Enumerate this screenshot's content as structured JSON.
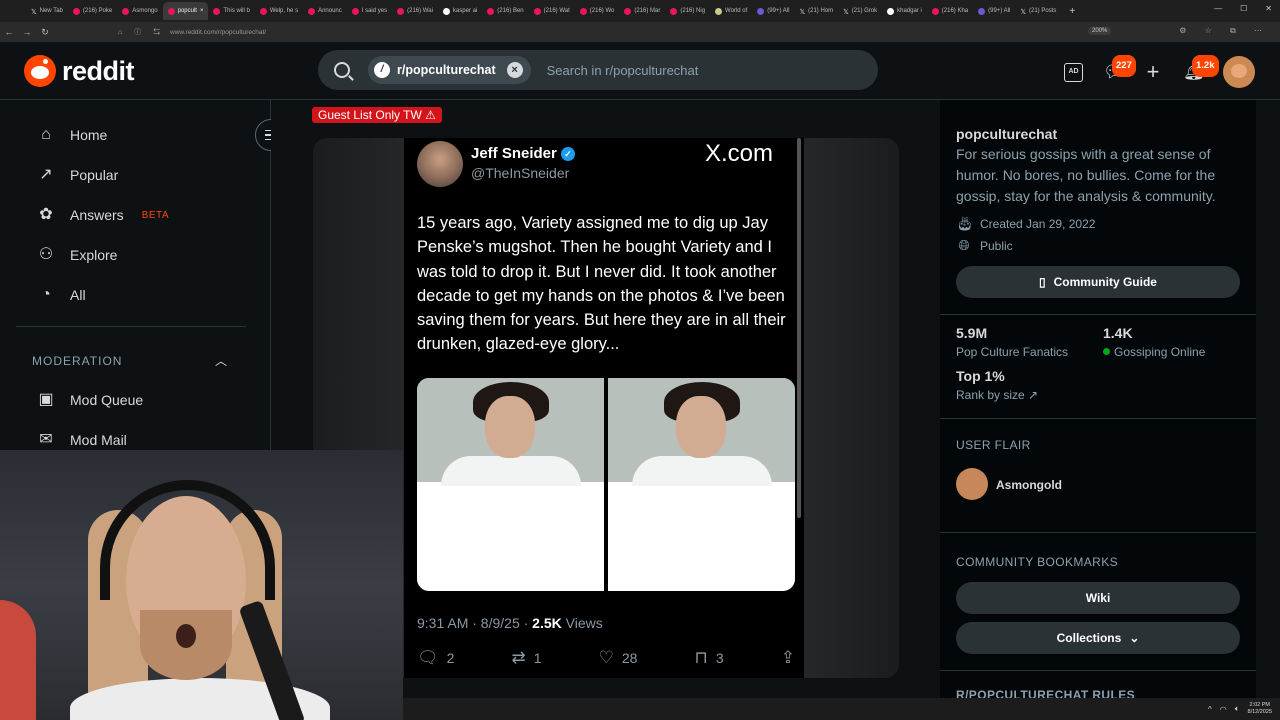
{
  "browser": {
    "tabs": [
      {
        "label": "New Tab",
        "icon": "x"
      },
      {
        "label": "(216) Poke",
        "icon": "y"
      },
      {
        "label": "Asmongo",
        "icon": "r"
      },
      {
        "label": "popcult",
        "icon": "r",
        "active": true
      },
      {
        "label": "This will b",
        "icon": "r"
      },
      {
        "label": "Welp, he s",
        "icon": "r"
      },
      {
        "label": "Announc",
        "icon": "r"
      },
      {
        "label": "I said yes",
        "icon": "r"
      },
      {
        "label": "(216) Wai",
        "icon": "y"
      },
      {
        "label": "kasper ai",
        "icon": "gh"
      },
      {
        "label": "(216) Ben",
        "icon": "y"
      },
      {
        "label": "(216) Wat",
        "icon": "y"
      },
      {
        "label": "(216) Wo",
        "icon": "y"
      },
      {
        "label": "(216) Mar",
        "icon": "y"
      },
      {
        "label": "(216) Nig",
        "icon": "y"
      },
      {
        "label": "World of",
        "icon": "w"
      },
      {
        "label": "(99+) All",
        "icon": "m"
      },
      {
        "label": "(21) Hom",
        "icon": "x"
      },
      {
        "label": "(21) Grok",
        "icon": "x"
      },
      {
        "label": "khadgar i",
        "icon": "gh"
      },
      {
        "label": "(216) Kha",
        "icon": "y"
      },
      {
        "label": "(99+) All",
        "icon": "m"
      },
      {
        "label": "(21) Posts",
        "icon": "x"
      }
    ],
    "new_tab_symbol": "+",
    "url": "www.reddit.com/r/popculturechat/",
    "zoom": "200%"
  },
  "header": {
    "logo_text": "reddit",
    "search_chip": "r/popculturechat",
    "search_placeholder": "Search in r/popculturechat",
    "chat_badge": "227",
    "notif_badge": "1.2k"
  },
  "sidebar": {
    "items": [
      {
        "label": "Home",
        "icon": "home-icon",
        "glyph": "⌂"
      },
      {
        "label": "Popular",
        "icon": "popular-icon",
        "glyph": "↗"
      },
      {
        "label": "Answers",
        "icon": "answers-icon",
        "glyph": "✿"
      },
      {
        "label": "Explore",
        "icon": "explore-icon",
        "glyph": "⚇"
      },
      {
        "label": "All",
        "icon": "all-icon",
        "glyph": "◔"
      }
    ],
    "answers_badge": "BETA",
    "moderation_heading": "MODERATION",
    "mod_items": [
      {
        "label": "Mod Queue",
        "glyph": "▣"
      },
      {
        "label": "Mod Mail",
        "glyph": "✉"
      }
    ]
  },
  "post": {
    "flair": "Guest List Only TW ⚠",
    "tweet": {
      "author": "Jeff Sneider",
      "handle": "@TheInSneider",
      "brand": "X.com",
      "text": "15 years ago, Variety assigned me to dig up Jay Penske’s mugshot. Then he bought Variety and I was told to drop it. But I never did. It took another decade to get my hands on the photos & I’ve been saving them for years. But here they are in all their drunken, glazed-eye glory...",
      "time": "9:31 AM · 8/9/25 · ",
      "views_count": "2.5K",
      "views_label": " Views",
      "replies": "2",
      "retweets": "1",
      "likes": "28",
      "bookmarks": "3"
    }
  },
  "community": {
    "name": "popculturechat",
    "description": "For serious gossips with a great sense of humor. No bores, no bullies. Come for the gossip, stay for the analysis & community.",
    "created": "Created Jan 29, 2022",
    "visibility": "Public",
    "guide_button": "Community Guide",
    "members_count": "5.9M",
    "members_label": "Pop Culture Fanatics",
    "online_count": "1.4K",
    "online_label": "Gossiping Online",
    "rank": "Top 1%",
    "rank_label": "Rank by size",
    "user_flair_heading": "USER FLAIR",
    "user_flair_name": "Asmongold",
    "bookmarks_heading": "COMMUNITY BOOKMARKS",
    "wiki_button": "Wiki",
    "collections_button": "Collections",
    "rules_heading": "R/POPCULTURECHAT RULES"
  },
  "taskbar": {
    "time": "2:02 PM",
    "date": "8/12/2025"
  },
  "colors": {
    "accent": "#ff4500",
    "flair_bg": "#d4141b",
    "online": "#01a816",
    "verified": "#1d9bf0"
  }
}
